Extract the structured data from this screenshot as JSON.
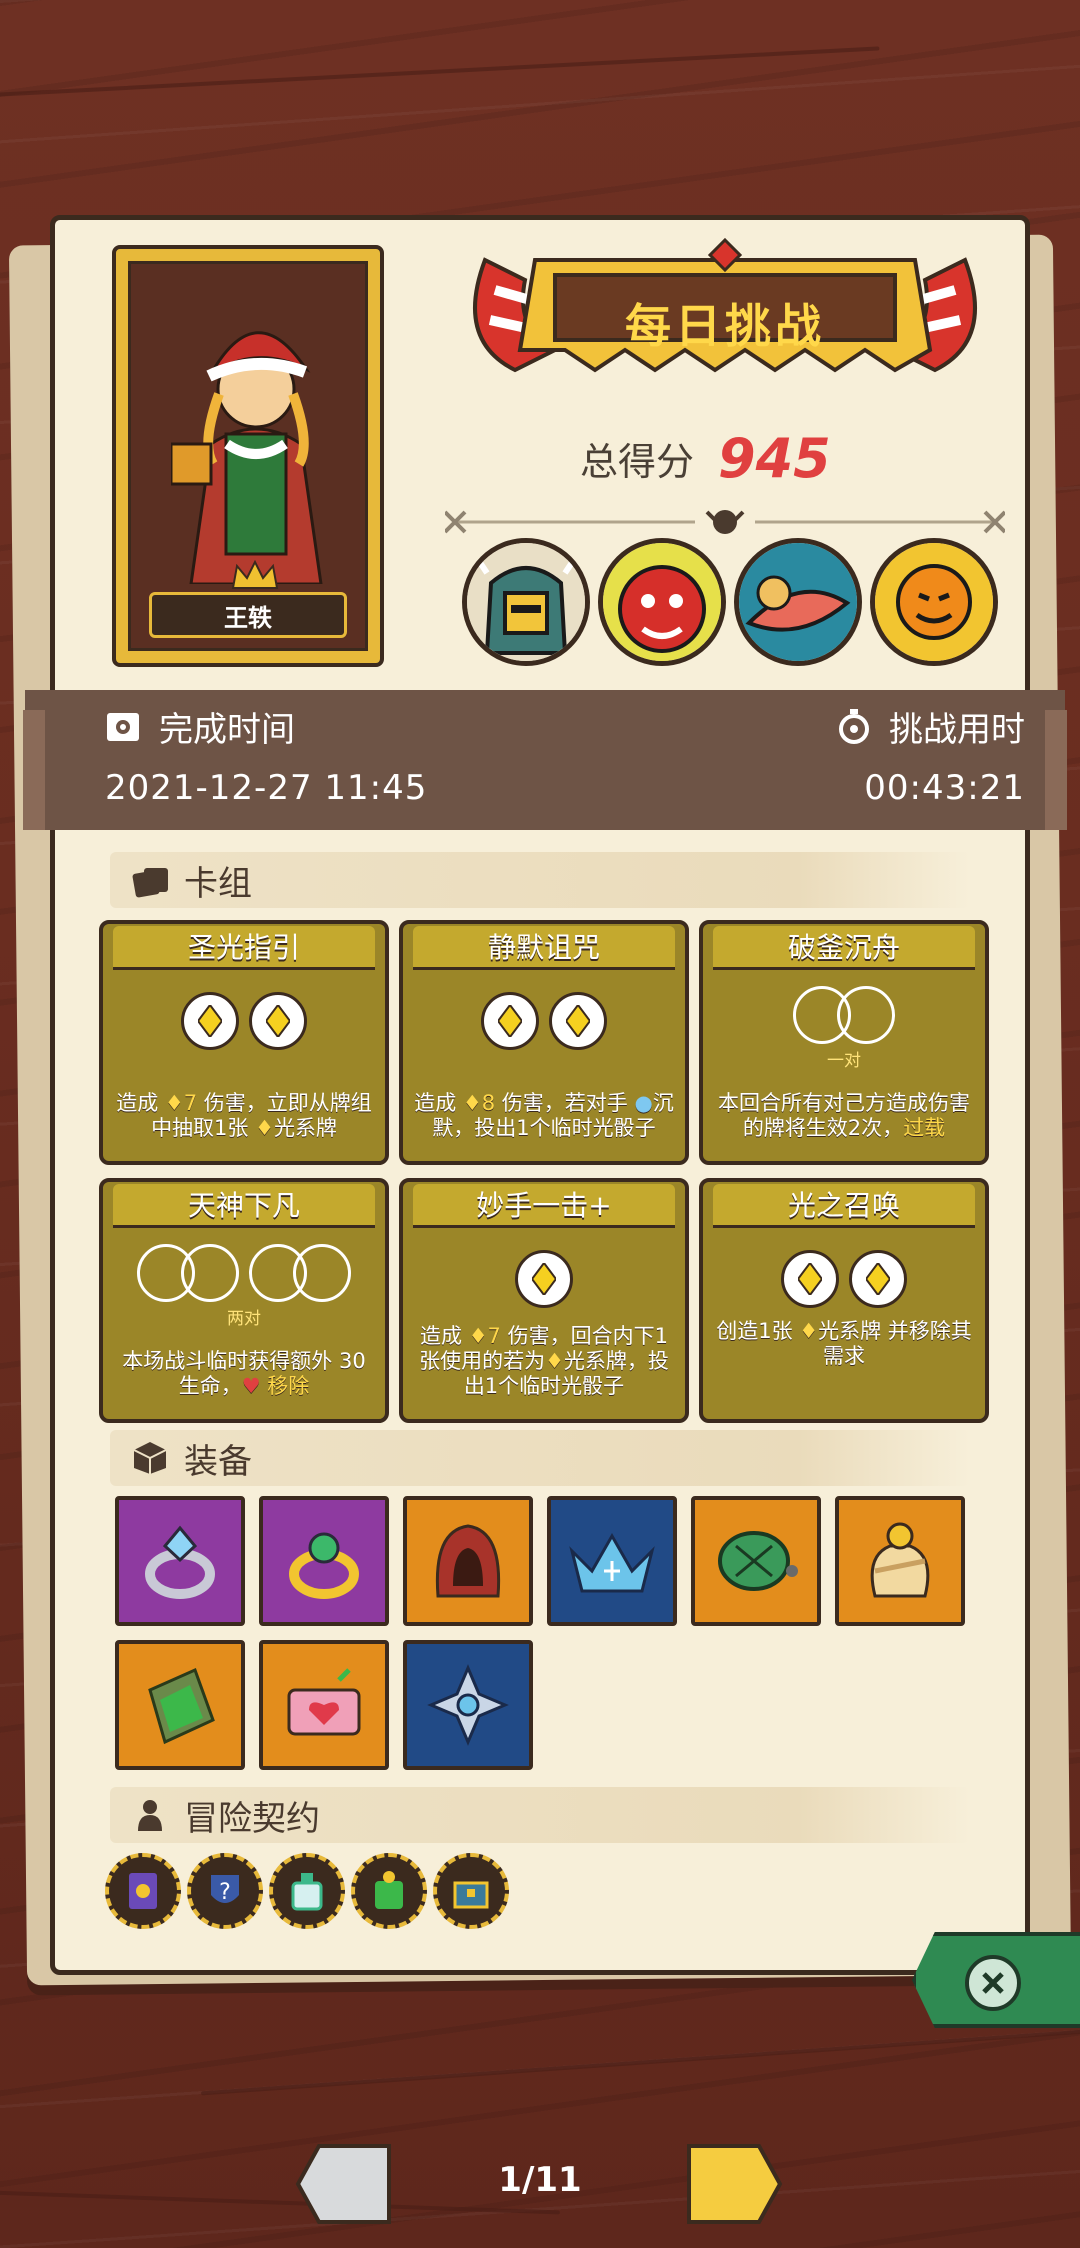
{
  "hero": {
    "name": "王轶"
  },
  "header": {
    "title": "每日挑战",
    "score_label": "总得分",
    "score_value": "945"
  },
  "bosses": [
    "knight-helmet-boss",
    "red-demon-boss",
    "fish-boss",
    "pumpkin-sun-boss"
  ],
  "times": {
    "completed_label": "完成时间",
    "completed_value": "2021-12-27 11:45",
    "duration_label": "挑战用时",
    "duration_value": "00:43:21"
  },
  "deck": {
    "title": "卡组",
    "cards": [
      {
        "name": "圣光指引",
        "dice": "two-light",
        "text_parts": [
          "造成 ",
          "7",
          " 伤害，立即从牌组中抽取1张 ",
          "光系牌"
        ]
      },
      {
        "name": "静默诅咒",
        "dice": "two-light",
        "text_parts": [
          "造成 ",
          "8",
          " 伤害，若对手 ",
          "沉默，投出1个临时光骰子"
        ]
      },
      {
        "name": "破釜沉舟",
        "dice_note": "一对",
        "text_main": "本回合所有对己方造成伤害的牌将生效2次，",
        "text_highlight": "过载"
      },
      {
        "name": "天神下凡",
        "dice_note": "两对",
        "text_main": "本场战斗临时获得额外 30 生命，",
        "text_highlight": "移除"
      },
      {
        "name": "妙手一击+",
        "dice": "one-light",
        "text_parts": [
          "造成 ",
          "7",
          " 伤害，回合内下1张使用的若为",
          "光系牌，投出1个临时光骰子"
        ]
      },
      {
        "name": "光之召唤",
        "dice": "two-light",
        "text_parts": [
          "创造1张 ",
          "光系牌 并移除其需求"
        ]
      }
    ]
  },
  "equipment": {
    "title": "装备",
    "items": [
      {
        "icon": "diamond-ring-icon",
        "rarity": "purple"
      },
      {
        "icon": "emerald-ring-icon",
        "rarity": "purple"
      },
      {
        "icon": "red-hood-icon",
        "rarity": "orange"
      },
      {
        "icon": "ice-crown-icon",
        "rarity": "blue"
      },
      {
        "icon": "turtle-shell-icon",
        "rarity": "orange"
      },
      {
        "icon": "gold-bag-icon",
        "rarity": "orange"
      },
      {
        "icon": "moss-stone-icon",
        "rarity": "orange"
      },
      {
        "icon": "heart-box-icon",
        "rarity": "orange"
      },
      {
        "icon": "silver-emblem-icon",
        "rarity": "blue"
      }
    ]
  },
  "contracts": {
    "title": "冒险契约",
    "items": [
      "eye-card-icon",
      "question-shield-icon",
      "potion-bottle-icon",
      "green-jar-icon",
      "treasure-chest-icon"
    ]
  },
  "pager": {
    "text": "1/11"
  },
  "colors": {
    "score": "#e04040",
    "card": "#9b8628",
    "panel": "#f7efd9",
    "close": "#2f8a52"
  }
}
